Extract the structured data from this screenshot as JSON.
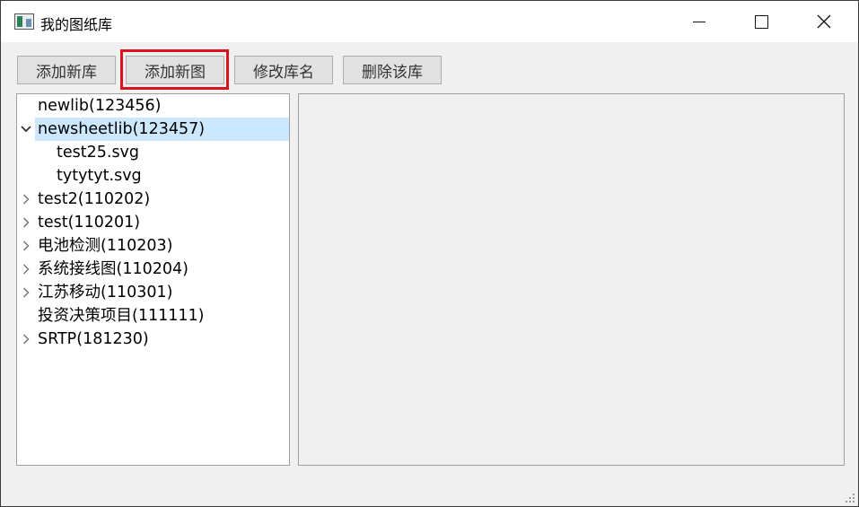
{
  "window": {
    "title": "我的图纸库"
  },
  "toolbar": {
    "add_lib": "添加新库",
    "add_sheet": "添加新图",
    "rename_lib": "修改库名",
    "delete_lib": "删除该库"
  },
  "tree": {
    "items": [
      {
        "label": "newlib(123456)",
        "expander": "none",
        "level": 0
      },
      {
        "label": "newsheetlib(123457)",
        "expander": "expanded",
        "level": 0,
        "selected": true
      },
      {
        "label": "test25.svg",
        "expander": "none",
        "level": 1
      },
      {
        "label": "tytytyt.svg",
        "expander": "none",
        "level": 1
      },
      {
        "label": "test2(110202)",
        "expander": "collapsed",
        "level": 0
      },
      {
        "label": "test(110201)",
        "expander": "collapsed",
        "level": 0
      },
      {
        "label": "电池检测(110203)",
        "expander": "collapsed",
        "level": 0
      },
      {
        "label": "系统接线图(110204)",
        "expander": "collapsed",
        "level": 0
      },
      {
        "label": "江苏移动(110301)",
        "expander": "collapsed",
        "level": 0
      },
      {
        "label": "投资决策项目(111111)",
        "expander": "none",
        "level": 0
      },
      {
        "label": "SRTP(181230)",
        "expander": "collapsed",
        "level": 0
      }
    ]
  },
  "colors": {
    "highlight_border": "#d9141e",
    "selection": "#cce8ff"
  }
}
